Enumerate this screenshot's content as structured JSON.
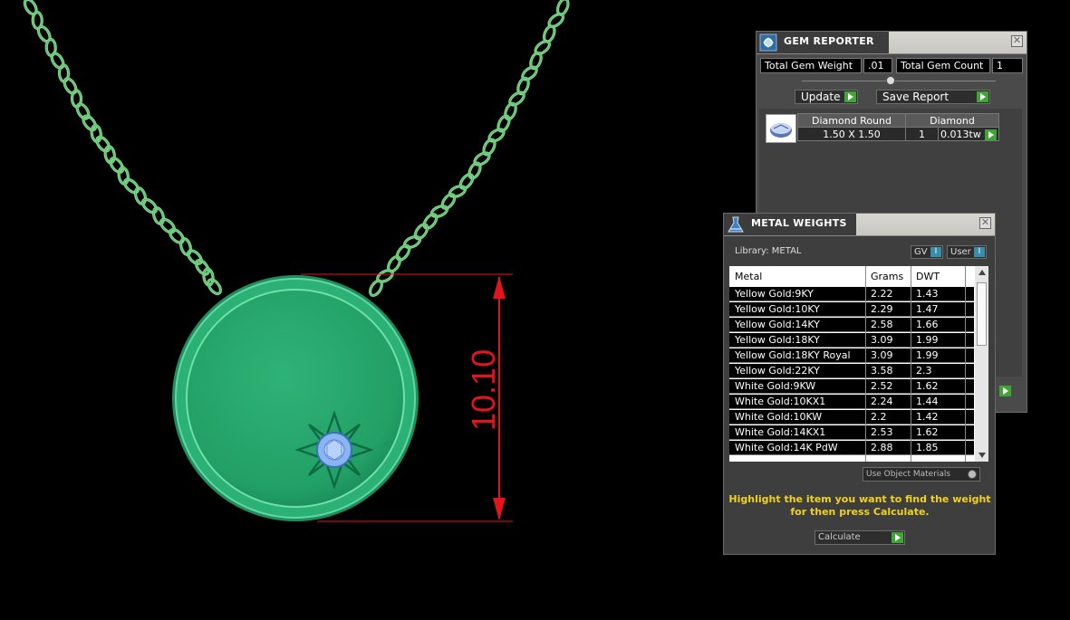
{
  "dimension": {
    "value": "10.10",
    "color": "#e3141c"
  },
  "colors": {
    "chain": "#7fd98a",
    "pendant": "#27a06a",
    "gem": "#8ab4f2",
    "accent": "#3fa535",
    "hint": "#f2d21d"
  },
  "gem_reporter": {
    "title": "GEM REPORTER",
    "icon": "gem-reporter-icon",
    "total_weight_label": "Total Gem Weight",
    "total_weight_value": ".01",
    "total_count_label": "Total Gem Count",
    "total_count_value": "1",
    "update_label": "Update",
    "save_report_label": "Save Report",
    "gem": {
      "shape": "Diamond Round",
      "material": "Diamond",
      "size": "1.50 X 1.50",
      "count": "1",
      "weight": "0.013tw"
    }
  },
  "metal_weights": {
    "title": "METAL WEIGHTS",
    "icon": "metal-flask-icon",
    "library_label": "Library: METAL",
    "gv_label": "GV",
    "user_label": "User",
    "columns": [
      "Metal",
      "Grams",
      "DWT"
    ],
    "rows": [
      {
        "metal": "Yellow Gold:9KY",
        "grams": "2.22",
        "dwt": "1.43"
      },
      {
        "metal": "Yellow Gold:10KY",
        "grams": "2.29",
        "dwt": "1.47"
      },
      {
        "metal": "Yellow Gold:14KY",
        "grams": "2.58",
        "dwt": "1.66"
      },
      {
        "metal": "Yellow Gold:18KY",
        "grams": "3.09",
        "dwt": "1.99"
      },
      {
        "metal": "Yellow Gold:18KY Royal",
        "grams": "3.09",
        "dwt": "1.99"
      },
      {
        "metal": "Yellow Gold:22KY",
        "grams": "3.58",
        "dwt": "2.3"
      },
      {
        "metal": "White Gold:9KW",
        "grams": "2.52",
        "dwt": "1.62"
      },
      {
        "metal": "White Gold:10KX1",
        "grams": "2.24",
        "dwt": "1.44"
      },
      {
        "metal": "White Gold:10KW",
        "grams": "2.2",
        "dwt": "1.42"
      },
      {
        "metal": "White Gold:14KX1",
        "grams": "2.53",
        "dwt": "1.62"
      },
      {
        "metal": "White Gold:14K PdW",
        "grams": "2.88",
        "dwt": "1.85"
      }
    ],
    "use_object_materials_label": "Use Object Materials",
    "hint_line1": "Highlight the item you want to find the weight",
    "hint_line2": "for then press Calculate.",
    "calculate_label": "Calculate"
  }
}
